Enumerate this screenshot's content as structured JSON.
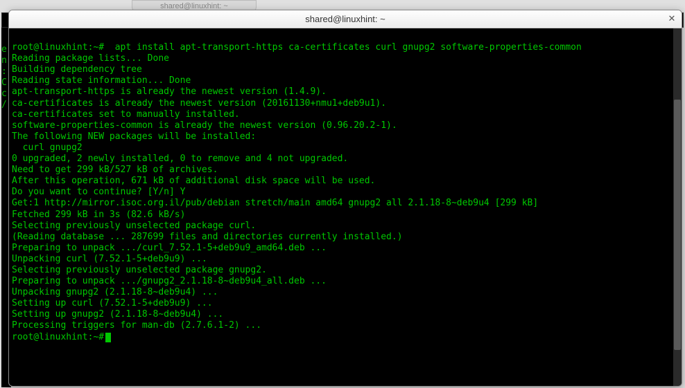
{
  "background": {
    "tab_title": "shared@linuxhint: ~",
    "left_strip": "e\nn\n:\nC\nc\n/"
  },
  "window": {
    "title": "shared@linuxhint: ~",
    "close_label": "✕"
  },
  "terminal": {
    "prompt1": "root@linuxhint:~#  apt install apt-transport-https ca-certificates curl gnupg2 software-properties-common",
    "lines": [
      "Reading package lists... Done",
      "Building dependency tree",
      "Reading state information... Done",
      "apt-transport-https is already the newest version (1.4.9).",
      "ca-certificates is already the newest version (20161130+nmu1+deb9u1).",
      "ca-certificates set to manually installed.",
      "software-properties-common is already the newest version (0.96.20.2-1).",
      "The following NEW packages will be installed:",
      "  curl gnupg2",
      "0 upgraded, 2 newly installed, 0 to remove and 4 not upgraded.",
      "Need to get 299 kB/527 kB of archives.",
      "After this operation, 671 kB of additional disk space will be used.",
      "Do you want to continue? [Y/n] Y",
      "Get:1 http://mirror.isoc.org.il/pub/debian stretch/main amd64 gnupg2 all 2.1.18-8~deb9u4 [299 kB]",
      "Fetched 299 kB in 3s (82.6 kB/s)",
      "Selecting previously unselected package curl.",
      "(Reading database ... 287699 files and directories currently installed.)",
      "Preparing to unpack .../curl_7.52.1-5+deb9u9_amd64.deb ...",
      "Unpacking curl (7.52.1-5+deb9u9) ...",
      "Selecting previously unselected package gnupg2.",
      "Preparing to unpack .../gnupg2_2.1.18-8~deb9u4_all.deb ...",
      "Unpacking gnupg2 (2.1.18-8~deb9u4) ...",
      "Setting up curl (7.52.1-5+deb9u9) ...",
      "Setting up gnupg2 (2.1.18-8~deb9u4) ...",
      "Processing triggers for man-db (2.7.6.1-2) ..."
    ],
    "prompt2": "root@linuxhint:~#"
  }
}
